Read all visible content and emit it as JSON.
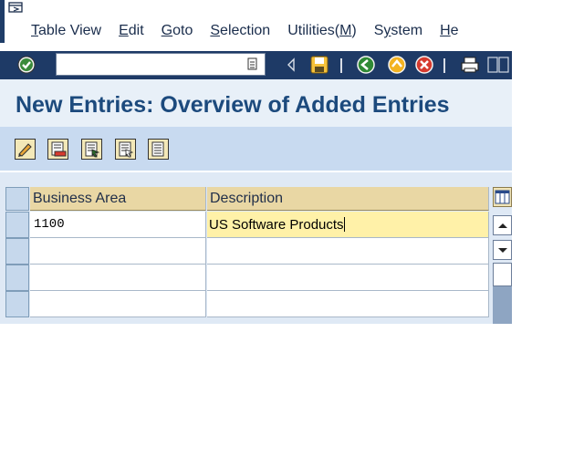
{
  "menubar": {
    "items": [
      "Table View",
      "Edit",
      "Goto",
      "Selection",
      "Utilities(M)",
      "System",
      "He"
    ]
  },
  "toolbar": {
    "command_value": "",
    "icons": [
      "enter-check-icon",
      "command-dropdown-icon",
      "back-arrow-icon",
      "save-icon",
      "back-green-icon",
      "exit-yellow-icon",
      "cancel-red-icon",
      "print-icon",
      "find-icon"
    ]
  },
  "page": {
    "title": "New Entries: Overview of Added Entries"
  },
  "app_toolbar": {
    "icons": [
      "change-pencil-icon",
      "delete-entry-icon",
      "select-all-icon",
      "select-block-icon",
      "deselect-all-icon"
    ]
  },
  "table": {
    "columns": [
      "Business Area",
      "Description"
    ],
    "rows": [
      {
        "business_area": "1100",
        "description": "US Software Products"
      },
      {
        "business_area": "",
        "description": ""
      },
      {
        "business_area": "",
        "description": ""
      },
      {
        "business_area": "",
        "description": ""
      }
    ]
  },
  "colors": {
    "toolbar_bg": "#1e3a66",
    "title_color": "#1c4a7d",
    "header_bg": "#e9d7a4",
    "edit_cell_bg": "#fff1a8"
  }
}
